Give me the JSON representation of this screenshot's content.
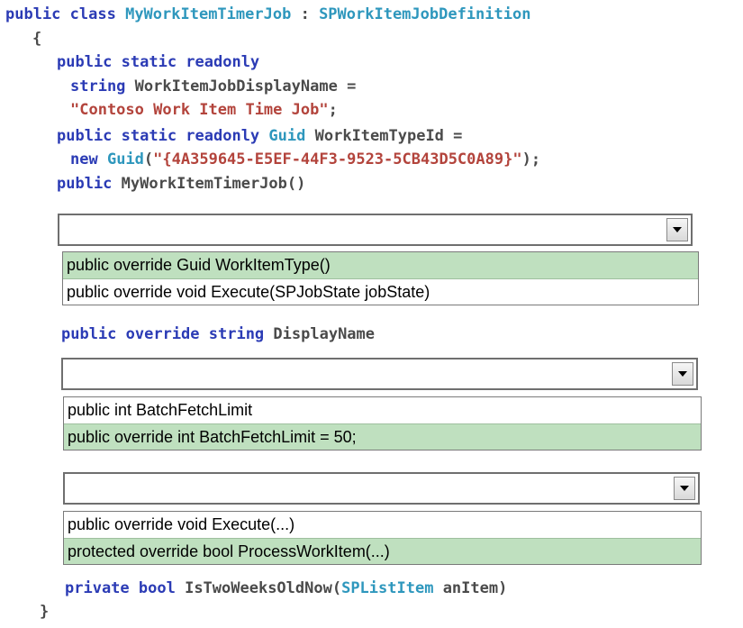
{
  "code": {
    "class_kw": "public class",
    "class_name": "MyWorkItemTimerJob",
    "colon": ":",
    "base_class": "SPWorkItemJobDefinition",
    "open_brace": "{",
    "l1_kw": "public static readonly",
    "l2_type": "string",
    "l2_rest": "WorkItemJobDisplayName =",
    "l3_str": "\"Contoso Work Item Time Job\"",
    "l3_semi": ";",
    "l4_kw": "public static readonly",
    "l4_type": "Guid",
    "l4_rest": "WorkItemTypeId =",
    "l5_kw": "new",
    "l5_type": "Guid",
    "l5_open": "(",
    "l5_str": "\"{4A359645-E5EF-44F3-9523-5CB43D5C0A89}\"",
    "l5_close": ");",
    "l6_kw": "public",
    "l6_rest": "MyWorkItemTimerJob()",
    "l7_kw": "public override string",
    "l7_rest": "DisplayName",
    "l8_kw": "private bool",
    "l8_name": "IsTwoWeeksOldNow(",
    "l8_type": "SPListItem",
    "l8_rest": "anItem)",
    "close_brace": "}"
  },
  "dropdowns": [
    {
      "selected": "",
      "options": [
        {
          "label": "public override Guid WorkItemType()",
          "highlighted": true
        },
        {
          "label": "public override void Execute(SPJobState jobState)",
          "highlighted": false
        }
      ]
    },
    {
      "selected": "",
      "options": [
        {
          "label": "public int BatchFetchLimit",
          "highlighted": false
        },
        {
          "label": "public override int BatchFetchLimit = 50;",
          "highlighted": true
        }
      ]
    },
    {
      "selected": "",
      "options": [
        {
          "label": "public override void Execute(...)",
          "highlighted": false
        },
        {
          "label": "protected override bool ProcessWorkItem(...)",
          "highlighted": true
        }
      ]
    }
  ],
  "colors": {
    "keyword": "#2b3bb5",
    "type": "#2e97bd",
    "string": "#b3443c",
    "highlight": "#bfe0bf"
  }
}
